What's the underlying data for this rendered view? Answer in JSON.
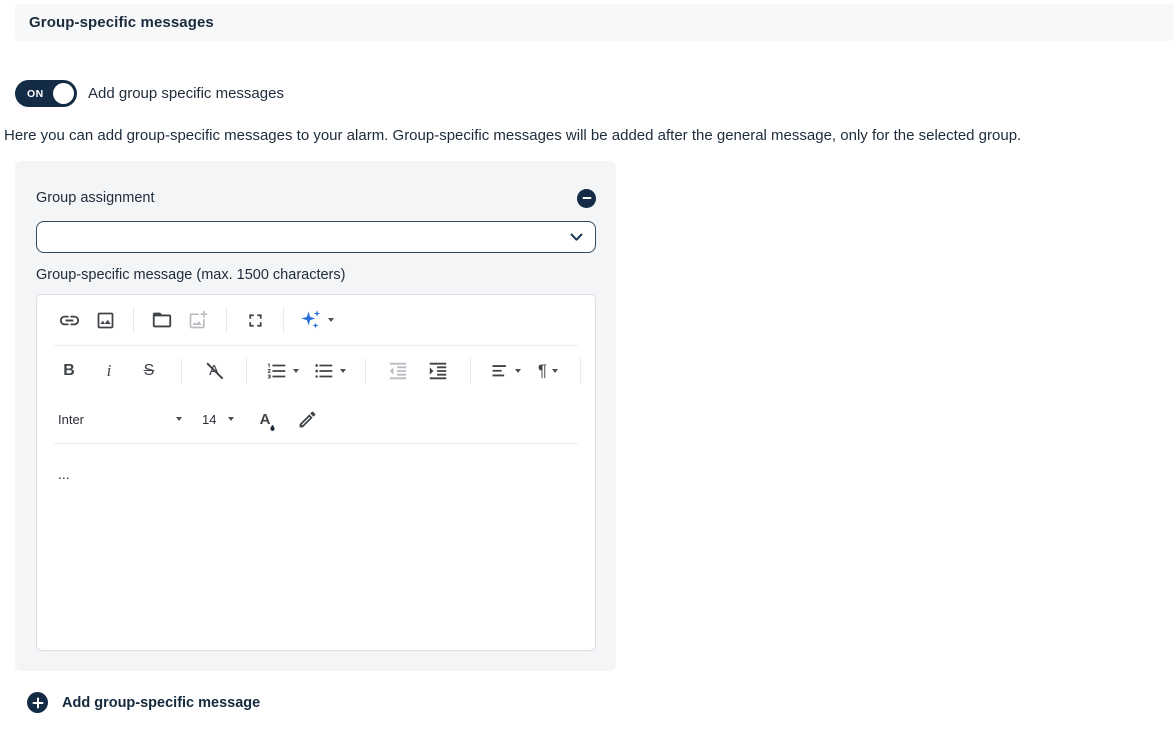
{
  "header": {
    "title": "Group-specific messages"
  },
  "toggle": {
    "state_label": "ON",
    "label": "Add group specific messages"
  },
  "description": "Here you can add group-specific messages to your alarm. Group-specific messages will be added after the general message, only for the selected group.",
  "group_card": {
    "assignment_label": "Group assignment",
    "assignment_selected": "",
    "message_label": "Group-specific message (max. 1500 characters)",
    "editor": {
      "toolbar": {
        "font_family": "Inter",
        "font_size": "14",
        "bold_glyph": "B",
        "italic_glyph": "i",
        "strike_glyph": "S",
        "clear_format_glyph": "A",
        "font_color_glyph": "A",
        "paragraph_glyph": "¶"
      },
      "content": "..."
    }
  },
  "add_message_button": {
    "label": "Add group-specific message"
  },
  "icons": {
    "minus-icon": "−",
    "plus-icon": "+",
    "chevron-down-icon": "⌄",
    "caret-down-icon": "▾",
    "link-icon": "chain link",
    "image-icon": "picture frame with mountain",
    "folder-open-icon": "open folder",
    "image-add-icon": "picture with plus (disabled)",
    "fullscreen-icon": "corner brackets",
    "ai-sparkles-icon": "blue sparkles",
    "ordered-list-icon": "numbered list",
    "unordered-list-icon": "bulleted list",
    "outdent-icon": "decrease indent (disabled)",
    "indent-icon": "increase indent",
    "align-icon": "left-aligned text lines",
    "font-color-icon": "A with ink drop",
    "highlighter-icon": "pen marker"
  },
  "colors": {
    "primary_navy": "#132b45",
    "accent_blue": "#2a6fd9",
    "header_bg": "#f7f8fa",
    "card_bg": "#f4f5f7",
    "text": "#1e2b3b",
    "disabled_icon": "#b9bcc1"
  }
}
